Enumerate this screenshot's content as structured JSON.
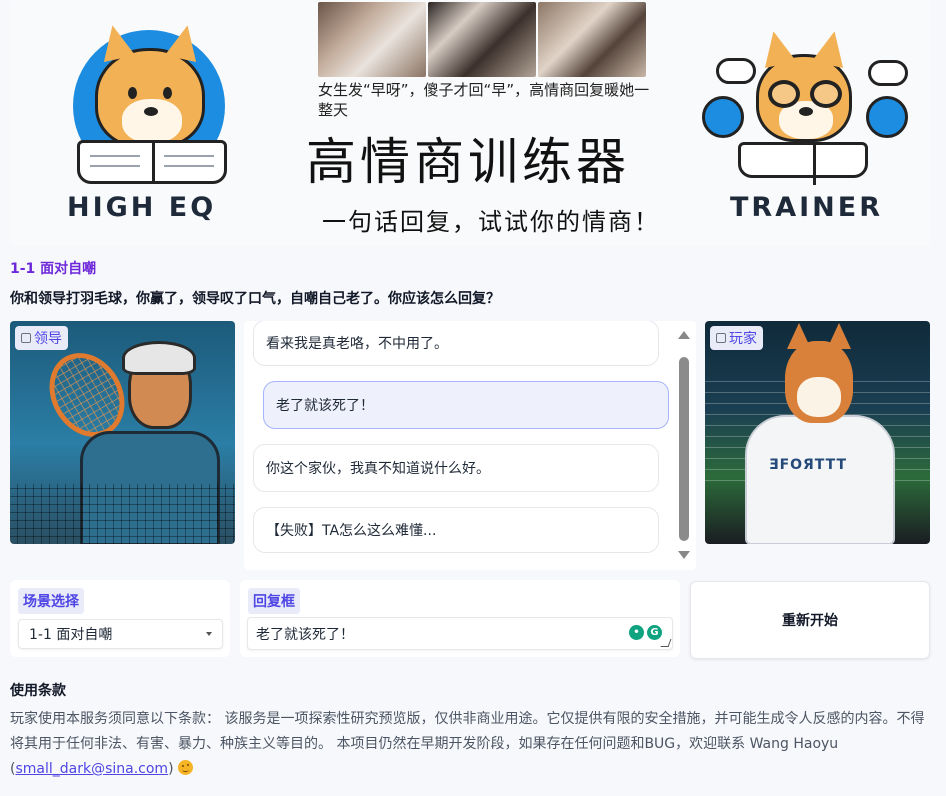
{
  "banner": {
    "logo_left_text": "HIGH EQ",
    "logo_right_text": "TRAINER",
    "caption": "女生发“早呀”，傻子才回“早”，高情商回复暖她一整天",
    "title": "高情商训练器",
    "subtitle": "一句话回复，试试你的情商！"
  },
  "scenario": {
    "name": "1-1 面对自嘲",
    "question": "你和领导打羽毛球，你赢了，领导叹了口气，自嘲自己老了。你应该怎么回复？"
  },
  "leader_card": {
    "label": "领导",
    "icon": "image-icon"
  },
  "player_card": {
    "label": "玩家",
    "icon": "image-icon",
    "shirt_text": "ƎFOЯTTT"
  },
  "chat": {
    "messages": [
      {
        "role": "leader",
        "text": "看来我是真老咯，不中用了。"
      },
      {
        "role": "player",
        "text": "老了就该死了！"
      },
      {
        "role": "leader",
        "text": "你这个家伙，我真不知道说什么好。"
      },
      {
        "role": "system",
        "text": "【失败】TA怎么这么难懂..."
      }
    ]
  },
  "scene_select": {
    "label": "场景选择",
    "value": "1-1 面对自嘲"
  },
  "reply_box": {
    "label": "回复框",
    "value": "老了就该死了！"
  },
  "restart_button": "重新开始",
  "terms": {
    "title": "使用条款",
    "body_prefix": "玩家使用本服务须同意以下条款： 该服务是一项探索性研究预览版，仅供非商业用途。它仅提供有限的安全措施，并可能生成令人反感的内容。不得将其用于任何非法、有害、暴力、种族主义等目的。 本项目仍然在早期开发阶段，如果存在任何问题和BUG，欢迎联系 Wang Haoyu (",
    "email": "small_dark@sina.com",
    "body_suffix": ")"
  },
  "colors": {
    "accent": "#4f46e5",
    "scenario_name": "#6d28d9",
    "user_bubble": "#eef0fb"
  }
}
